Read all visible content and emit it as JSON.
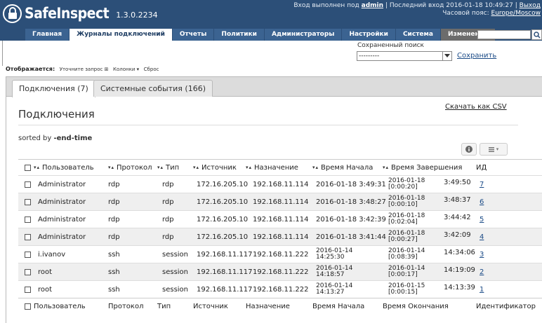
{
  "app": {
    "name": "SafeInspect",
    "version": "1.3.0.2234"
  },
  "login": {
    "prefix": "Вход выполнен под",
    "user": "admin",
    "separator": "|",
    "last_login_label": "Последний вход",
    "last_login": "2016-01-18 10:49:27",
    "logout": "Выход",
    "timezone_label": "Часовой пояс:",
    "timezone": "Europe/Moscow"
  },
  "nav": {
    "tabs": [
      "Главная",
      "Журналы подключений",
      "Отчеты",
      "Политики",
      "Администраторы",
      "Настройки",
      "Система",
      "Изменения"
    ],
    "active_index": 1,
    "search_placeholder": ""
  },
  "saved_search": {
    "label": "Сохраненный поиск",
    "selected": "---------",
    "save_label": "Сохранить"
  },
  "display_bar": {
    "label": "Отображается:",
    "refine": "Уточните запрос ⊞",
    "columns": "Колонки ▾",
    "reset": "Сброс"
  },
  "panel": {
    "tabs": [
      "Подключения (7)",
      "Системные события (166)"
    ],
    "active_tab": 0,
    "title": "Подключения",
    "csv": "Скачать как CSV",
    "sorted_prefix": "sorted by",
    "sorted_field": "-end-time"
  },
  "table": {
    "sort_glyph": "▾▴",
    "headers": [
      "Пользователь",
      "Протокол",
      "Тип",
      "Источник",
      "Назначение",
      "Время Начала",
      "Время Завершения",
      "ИД"
    ],
    "rows": [
      {
        "user": "Administrator",
        "protocol": "rdp",
        "type": "rdp",
        "source": "172.16.205.10",
        "dest": "192.168.11.114",
        "start_a": "2016-01-18 3:49:31",
        "start_b": "",
        "end_date": "2016-01-18",
        "end_dur": "[0:00:20]",
        "end_time": "3:49:50",
        "id": "7"
      },
      {
        "user": "Administrator",
        "protocol": "rdp",
        "type": "rdp",
        "source": "172.16.205.10",
        "dest": "192.168.11.114",
        "start_a": "2016-01-18 3:48:27",
        "start_b": "",
        "end_date": "2016-01-18",
        "end_dur": "[0:00:10]",
        "end_time": "3:48:37",
        "id": "6"
      },
      {
        "user": "Administrator",
        "protocol": "rdp",
        "type": "rdp",
        "source": "172.16.205.10",
        "dest": "192.168.11.114",
        "start_a": "2016-01-18 3:42:39",
        "start_b": "",
        "end_date": "2016-01-18",
        "end_dur": "[0:02:04]",
        "end_time": "3:44:42",
        "id": "5"
      },
      {
        "user": "Administrator",
        "protocol": "rdp",
        "type": "rdp",
        "source": "172.16.205.10",
        "dest": "192.168.11.114",
        "start_a": "2016-01-18 3:41:44",
        "start_b": "",
        "end_date": "2016-01-18",
        "end_dur": "[0:00:27]",
        "end_time": "3:42:09",
        "id": "4"
      },
      {
        "user": "i.ivanov",
        "protocol": "ssh",
        "type": "session",
        "source": "192.168.11.117",
        "dest": "192.168.11.222",
        "start_a": "2016-01-14",
        "start_b": "14:25:30",
        "end_date": "2016-01-14",
        "end_dur": "[0:08:39]",
        "end_time": "14:34:06",
        "id": "3"
      },
      {
        "user": "root",
        "protocol": "ssh",
        "type": "session",
        "source": "192.168.11.117",
        "dest": "192.168.11.222",
        "start_a": "2016-01-14",
        "start_b": "14:18:57",
        "end_date": "2016-01-14",
        "end_dur": "[0:00:17]",
        "end_time": "14:19:09",
        "id": "2"
      },
      {
        "user": "root",
        "protocol": "ssh",
        "type": "session",
        "source": "192.168.11.117",
        "dest": "192.168.11.222",
        "start_a": "2016-01-14",
        "start_b": "14:13:27",
        "end_date": "2016-01-15",
        "end_dur": "[0:00:15]",
        "end_time": "14:13:39",
        "id": "1"
      }
    ],
    "footer": [
      "Пользователь",
      "Протокол",
      "Тип",
      "Источник",
      "Назначение",
      "Время Начала",
      "Время Окончания",
      "Идентификатор"
    ]
  },
  "icons": {
    "logo": "padlock-icon",
    "search": "search-icon",
    "info": "info-icon",
    "columns": "columns-icon"
  },
  "colors": {
    "header": "#2c4f78",
    "nav_tab": "#3b6391",
    "changes_tab": "#6c6c6c",
    "link": "#1a4a86",
    "row_alt": "#efefef"
  }
}
